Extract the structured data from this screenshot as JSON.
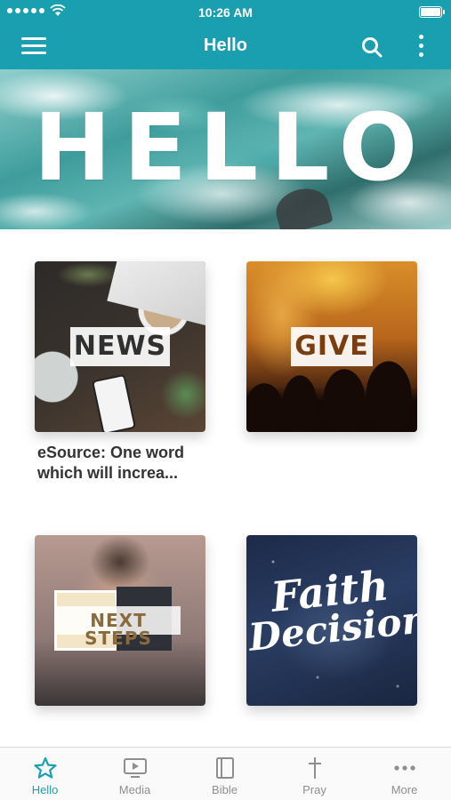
{
  "status_bar": {
    "time": "10:26 AM"
  },
  "nav": {
    "title": "Hello"
  },
  "hero": {
    "text": "HELLO"
  },
  "tiles": [
    {
      "label": "NEWS",
      "caption": "eSource: One word which will increa..."
    },
    {
      "label": "GIVE"
    },
    {
      "label": "NEXT STEPS"
    },
    {
      "label_line1": "Faith",
      "label_line2": "Decision"
    }
  ],
  "tab_bar": {
    "items": [
      {
        "label": "Hello",
        "icon": "star-icon",
        "active": true
      },
      {
        "label": "Media",
        "icon": "tv-icon",
        "active": false
      },
      {
        "label": "Bible",
        "icon": "book-icon",
        "active": false
      },
      {
        "label": "Pray",
        "icon": "cross-icon",
        "active": false
      },
      {
        "label": "More",
        "icon": "ellipsis-icon",
        "active": false
      }
    ]
  },
  "colors": {
    "accent": "#1a9fb0",
    "tab_inactive": "#8e8e8e"
  }
}
